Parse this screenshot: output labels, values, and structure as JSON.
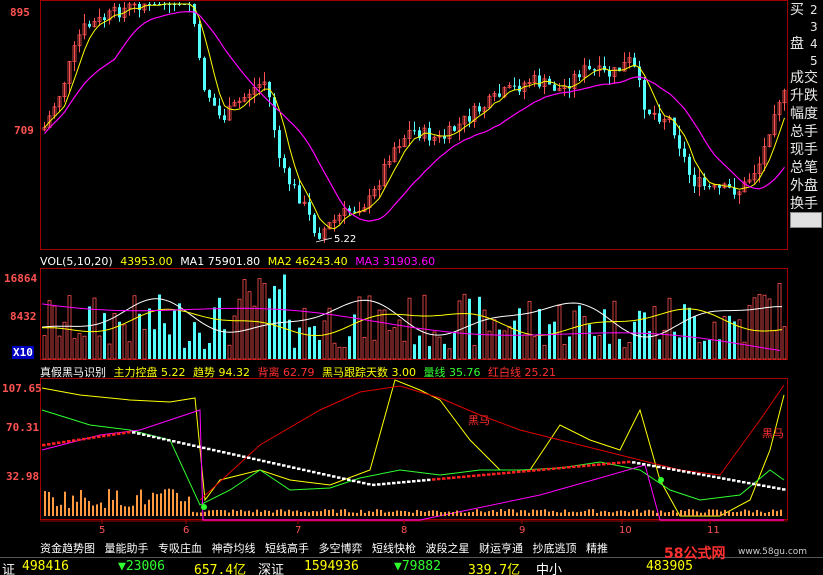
{
  "main_axis": {
    "top": "895",
    "mid": "709"
  },
  "price_low_annotation": "5.22",
  "vol_bar": {
    "label": "VOL(5,10,20)",
    "val": "43953.00",
    "ma1": "MA1 75901.80",
    "ma2": "MA2 46243.40",
    "ma3": "MA3 31903.60"
  },
  "vol_axis": {
    "top": "16864",
    "mid": "8432",
    "unit": "X10"
  },
  "ind_bar": {
    "name": "真假黑马识别",
    "f1": "主力控盘 5.22",
    "f2": "趋势 94.32",
    "f3": "背离 62.79",
    "f4": "黑马跟踪天数 3.00",
    "f5": "量线 35.76",
    "f6": "红白线 25.21"
  },
  "ind_axis": {
    "top": "107.65",
    "mid": "70.31",
    "low": "32.98"
  },
  "ind_labels": {
    "a": "黑马",
    "b": "黑马"
  },
  "month_ticks": [
    "5",
    "6",
    "7",
    "8",
    "9",
    "10",
    "11"
  ],
  "right_panel": [
    "买",
    "盘",
    "2",
    "3",
    "4",
    "5",
    "成交",
    "升跌",
    "幅度",
    "总手",
    "现手",
    "总笔",
    "外盘",
    "换手"
  ],
  "menu": [
    "资金趋势图",
    "量能助手",
    "专吸庄血",
    "神奇均线",
    "短线高手",
    "多空博弈",
    "短线快枪",
    "波段之星",
    "财运亨通",
    "抄底逃顶",
    "精推"
  ],
  "status": {
    "s1": "证",
    "s2": "498416",
    "s3": "▼23006",
    "s4": "657.4亿",
    "s5": "深证",
    "s6": "1594936",
    "s7": "▼79882",
    "s8": "339.7亿",
    "s9": "中小",
    "s10": "483905"
  },
  "watermark": "58公式网",
  "watermark_url": "www.58gu.com",
  "colors": {
    "up": "#ff5252",
    "down": "#54ffff",
    "ma_yellow": "#ffff00",
    "ma_magenta": "#ff00ff",
    "frame": "#a00000",
    "axis_text": "#ff5252"
  }
}
